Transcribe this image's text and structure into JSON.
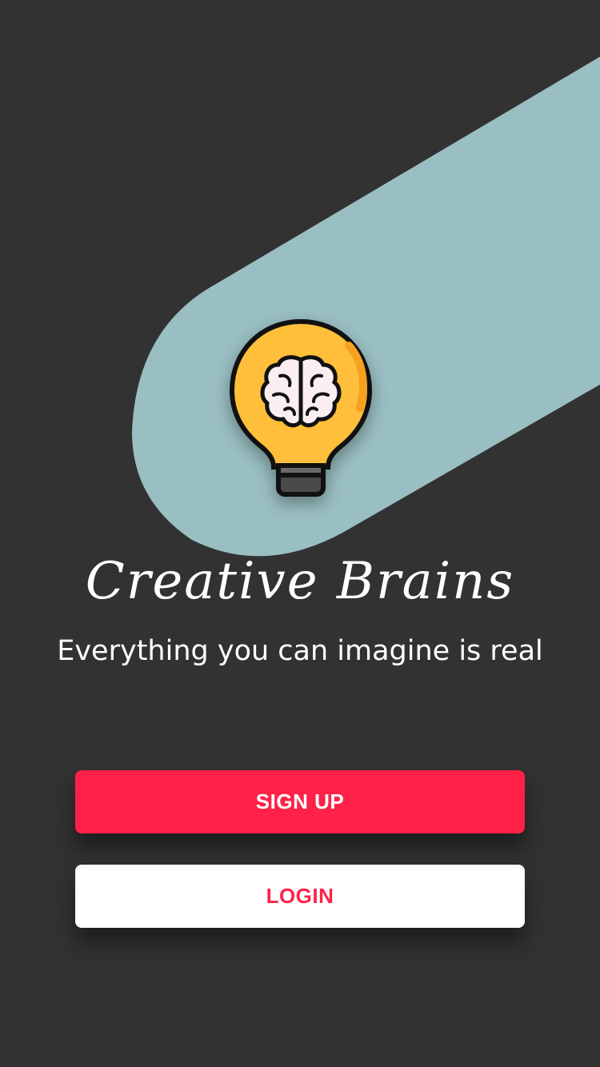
{
  "app": {
    "name": "Creative Brains",
    "tagline": "Everything you can imagine is real"
  },
  "actions": {
    "signup_label": "SIGN UP",
    "login_label": "LOGIN"
  },
  "icons": {
    "logo": "lightbulb-brain-icon"
  },
  "colors": {
    "background": "#333232",
    "swoosh": "#9abfc3",
    "accent": "#ff2148",
    "bulb": "#ffbf3a",
    "login_bg": "#ffffff"
  }
}
